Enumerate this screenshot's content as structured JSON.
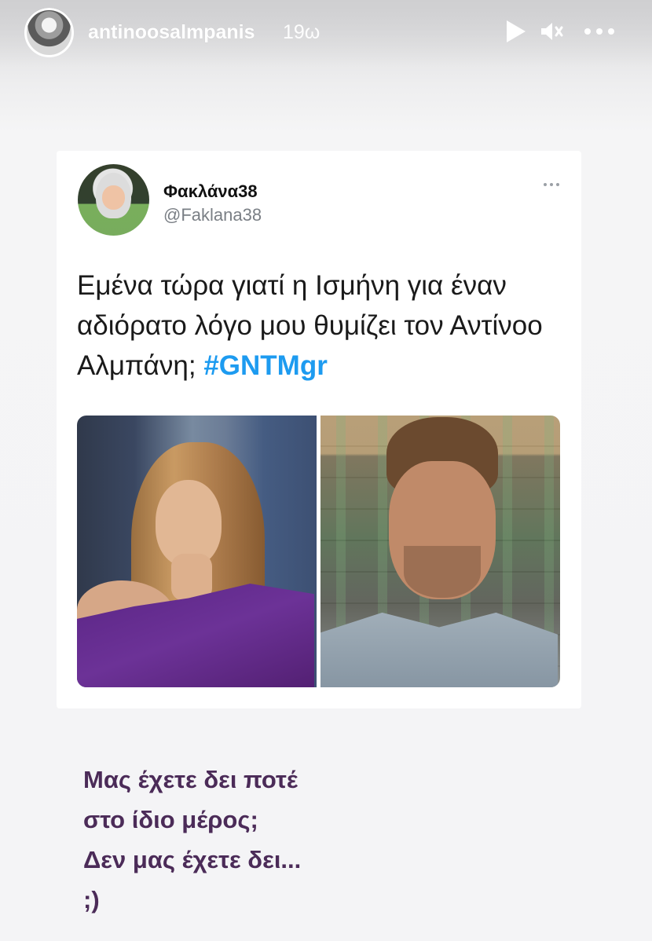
{
  "story": {
    "username": "antinoosalmpanis",
    "time_ago": "19ω",
    "controls": {
      "play_icon": "play-icon",
      "mute_icon": "mute-icon",
      "more_icon": "more-icon"
    }
  },
  "tweet": {
    "display_name": "Φακλάνα38",
    "handle": "@Faklana38",
    "text_before_hashtag": "Εμένα τώρα γιατί η Ισμήνη για έναν αδιόρατο λόγο μου θυμίζει τον Αντίνοο Αλμπάνη; ",
    "hashtag": "#GNTMgr",
    "more_icon": "more-icon"
  },
  "caption": {
    "text": "Μας έχετε δει ποτέ\nστο ίδιο μέρος;\nΔεν μας έχετε δει...\n;)"
  },
  "colors": {
    "hashtag": "#1d9bf0",
    "caption": "#4b2b58",
    "header_text": "#ffffff"
  }
}
